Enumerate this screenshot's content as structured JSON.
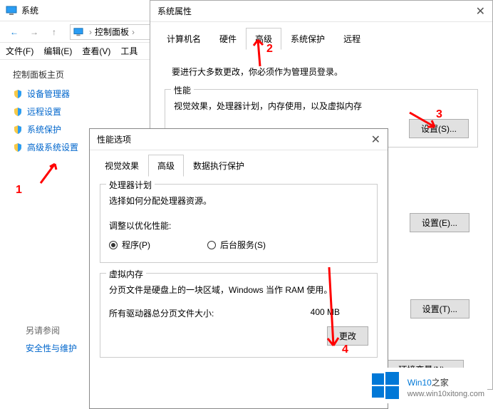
{
  "main": {
    "title": "系统",
    "breadcrumb": {
      "item1": "控制面板",
      "sep": "›"
    },
    "menu": {
      "file": "文件(F)",
      "edit": "编辑(E)",
      "view": "查看(V)",
      "tools": "工具"
    },
    "sidebar": {
      "title": "控制面板主页",
      "items": [
        {
          "label": "设备管理器"
        },
        {
          "label": "远程设置"
        },
        {
          "label": "系统保护"
        },
        {
          "label": "高级系统设置"
        }
      ]
    },
    "see_also": {
      "title": "另请参阅",
      "link": "安全性与维护"
    }
  },
  "sysprops": {
    "title": "系统属性",
    "tabs": {
      "computer": "计算机名",
      "hardware": "硬件",
      "advanced": "高级",
      "protection": "系统保护",
      "remote": "远程"
    },
    "admin_note": "要进行大多数更改，你必须作为管理员登录。",
    "perf": {
      "title": "性能",
      "desc": "视觉效果，处理器计划，内存使用，以及虚拟内存",
      "btn": "设置(S)..."
    },
    "user": {
      "btn": "设置(E)..."
    },
    "startup": {
      "btn": "设置(T)..."
    },
    "env_btn": "环境变量(N)..."
  },
  "perfopts": {
    "title": "性能选项",
    "tabs": {
      "visual": "视觉效果",
      "advanced": "高级",
      "dep": "数据执行保护"
    },
    "sched": {
      "title": "处理器计划",
      "desc": "选择如何分配处理器资源。",
      "adjust": "调整以优化性能:",
      "programs": "程序(P)",
      "background": "后台服务(S)"
    },
    "vm": {
      "title": "虚拟内存",
      "desc": "分页文件是硬盘上的一块区域，Windows 当作 RAM 使用。",
      "total_label": "所有驱动器总分页文件大小:",
      "total_value": "400 MB",
      "change_btn": "更改"
    }
  },
  "anno": {
    "n1": "1",
    "n2": "2",
    "n3": "3",
    "n4": "4"
  },
  "watermark": {
    "brand_a": "Win10",
    "brand_b": "之家",
    "url": "www.win10xitong.com"
  }
}
